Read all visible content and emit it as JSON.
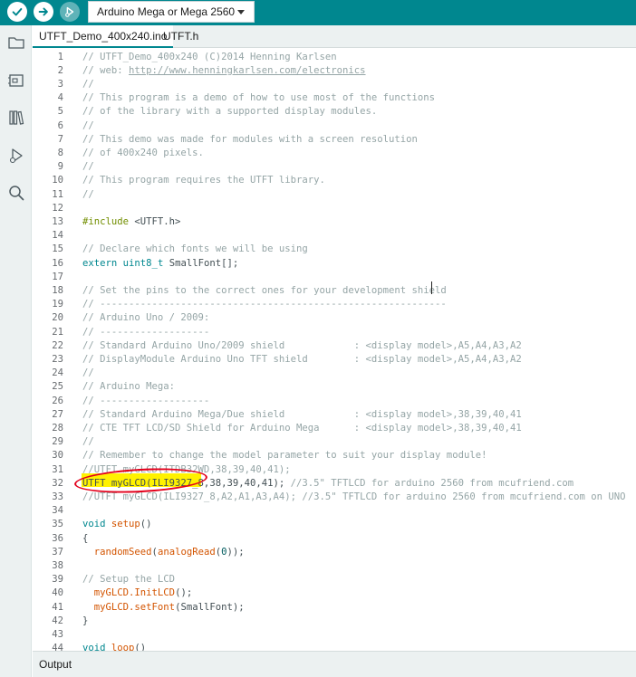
{
  "toolbar": {
    "verify_icon": "check-icon",
    "upload_icon": "arrow-right-icon",
    "debug_icon": "debug-icon",
    "board": "Arduino Mega or Mega 2560"
  },
  "sidebar": {
    "items": [
      {
        "icon": "folder-icon"
      },
      {
        "icon": "board-manager-icon"
      },
      {
        "icon": "library-icon"
      },
      {
        "icon": "debug-icon"
      },
      {
        "icon": "search-icon"
      }
    ]
  },
  "tabs": [
    {
      "label": "UTFT_Demo_400x240.ino",
      "active": true
    },
    {
      "label": "UTFT.h",
      "active": false
    }
  ],
  "code_lines": [
    {
      "n": "1",
      "tokens": [
        {
          "c": "cm",
          "t": "// UTFT_Demo_400x240 (C)2014 Henning Karlsen"
        }
      ]
    },
    {
      "n": "2",
      "tokens": [
        {
          "c": "cm",
          "t": "// web: "
        },
        {
          "c": "cm link",
          "t": "http://www.henningkarlsen.com/electronics"
        }
      ]
    },
    {
      "n": "3",
      "tokens": [
        {
          "c": "cm",
          "t": "//"
        }
      ]
    },
    {
      "n": "4",
      "tokens": [
        {
          "c": "cm",
          "t": "// This program is a demo of how to use most of the functions"
        }
      ]
    },
    {
      "n": "5",
      "tokens": [
        {
          "c": "cm",
          "t": "// of the library with a supported display modules."
        }
      ]
    },
    {
      "n": "6",
      "tokens": [
        {
          "c": "cm",
          "t": "//"
        }
      ]
    },
    {
      "n": "7",
      "tokens": [
        {
          "c": "cm",
          "t": "// This demo was made for modules with a screen resolution"
        }
      ]
    },
    {
      "n": "8",
      "tokens": [
        {
          "c": "cm",
          "t": "// of 400x240 pixels."
        }
      ]
    },
    {
      "n": "9",
      "tokens": [
        {
          "c": "cm",
          "t": "//"
        }
      ]
    },
    {
      "n": "10",
      "tokens": [
        {
          "c": "cm",
          "t": "// This program requires the UTFT library."
        }
      ]
    },
    {
      "n": "11",
      "tokens": [
        {
          "c": "cm",
          "t": "//"
        }
      ]
    },
    {
      "n": "12",
      "tokens": []
    },
    {
      "n": "13",
      "tokens": [
        {
          "c": "pp",
          "t": "#include"
        },
        {
          "c": "tx",
          "t": " <UTFT.h>"
        }
      ]
    },
    {
      "n": "14",
      "tokens": []
    },
    {
      "n": "15",
      "tokens": [
        {
          "c": "cm",
          "t": "// Declare which fonts we will be using"
        }
      ]
    },
    {
      "n": "16",
      "tokens": [
        {
          "c": "kw",
          "t": "extern"
        },
        {
          "c": "tx",
          "t": " "
        },
        {
          "c": "kw",
          "t": "uint8_t"
        },
        {
          "c": "tx",
          "t": " SmallFont[];"
        }
      ]
    },
    {
      "n": "17",
      "tokens": []
    },
    {
      "n": "18",
      "tokens": [
        {
          "c": "cm",
          "t": "// Set the pins to the correct ones for your development shield"
        }
      ]
    },
    {
      "n": "19",
      "tokens": [
        {
          "c": "cm",
          "t": "// ------------------------------------------------------------"
        }
      ]
    },
    {
      "n": "20",
      "tokens": [
        {
          "c": "cm",
          "t": "// Arduino Uno / 2009:"
        }
      ]
    },
    {
      "n": "21",
      "tokens": [
        {
          "c": "cm",
          "t": "// -------------------"
        }
      ]
    },
    {
      "n": "22",
      "tokens": [
        {
          "c": "cm",
          "t": "// Standard Arduino Uno/2009 shield            : <display model>,A5,A4,A3,A2"
        }
      ]
    },
    {
      "n": "23",
      "tokens": [
        {
          "c": "cm",
          "t": "// DisplayModule Arduino Uno TFT shield        : <display model>,A5,A4,A3,A2"
        }
      ]
    },
    {
      "n": "24",
      "tokens": [
        {
          "c": "cm",
          "t": "//"
        }
      ]
    },
    {
      "n": "25",
      "tokens": [
        {
          "c": "cm",
          "t": "// Arduino Mega:"
        }
      ]
    },
    {
      "n": "26",
      "tokens": [
        {
          "c": "cm",
          "t": "// -------------------"
        }
      ]
    },
    {
      "n": "27",
      "tokens": [
        {
          "c": "cm",
          "t": "// Standard Arduino Mega/Due shield            : <display model>,38,39,40,41"
        }
      ]
    },
    {
      "n": "28",
      "tokens": [
        {
          "c": "cm",
          "t": "// CTE TFT LCD/SD Shield for Arduino Mega      : <display model>,38,39,40,41"
        }
      ]
    },
    {
      "n": "29",
      "tokens": [
        {
          "c": "cm",
          "t": "//"
        }
      ]
    },
    {
      "n": "30",
      "tokens": [
        {
          "c": "cm",
          "t": "// Remember to change the model parameter to suit your display module!"
        }
      ]
    },
    {
      "n": "31",
      "tokens": [
        {
          "c": "cm",
          "t": "//UTFT myGLCD(ITDB32WD,38,39,40,41);"
        }
      ]
    },
    {
      "n": "32",
      "tokens": [
        {
          "c": "tx",
          "t": "UTFT myGLCD(ILI9327_8,38,39,40,41); "
        },
        {
          "c": "cm",
          "t": "//3.5\" TFTLCD for arduino 2560 from mcufriend.com"
        }
      ]
    },
    {
      "n": "33",
      "tokens": [
        {
          "c": "cm",
          "t": "//UTFT myGLCD(ILI9327_8,A2,A1,A3,A4); //3.5\" TFTLCD for arduino 2560 from mcufriend.com on UNO"
        }
      ]
    },
    {
      "n": "34",
      "tokens": []
    },
    {
      "n": "35",
      "tokens": [
        {
          "c": "kw",
          "t": "void"
        },
        {
          "c": "tx",
          "t": " "
        },
        {
          "c": "fn",
          "t": "setup"
        },
        {
          "c": "tx",
          "t": "()"
        }
      ]
    },
    {
      "n": "36",
      "tokens": [
        {
          "c": "tx",
          "t": "{"
        }
      ]
    },
    {
      "n": "37",
      "tokens": [
        {
          "c": "tx",
          "t": "  "
        },
        {
          "c": "fn",
          "t": "randomSeed"
        },
        {
          "c": "tx",
          "t": "("
        },
        {
          "c": "fn",
          "t": "analogRead"
        },
        {
          "c": "tx",
          "t": "("
        },
        {
          "c": "num",
          "t": "0"
        },
        {
          "c": "tx",
          "t": "));"
        }
      ]
    },
    {
      "n": "38",
      "tokens": []
    },
    {
      "n": "39",
      "tokens": [
        {
          "c": "cm",
          "t": "// Setup the LCD"
        }
      ]
    },
    {
      "n": "40",
      "tokens": [
        {
          "c": "tx",
          "t": "  "
        },
        {
          "c": "fn",
          "t": "myGLCD.InitLCD"
        },
        {
          "c": "tx",
          "t": "();"
        }
      ]
    },
    {
      "n": "41",
      "tokens": [
        {
          "c": "tx",
          "t": "  "
        },
        {
          "c": "fn",
          "t": "myGLCD.setFont"
        },
        {
          "c": "tx",
          "t": "(SmallFont);"
        }
      ]
    },
    {
      "n": "42",
      "tokens": [
        {
          "c": "tx",
          "t": "}"
        }
      ]
    },
    {
      "n": "43",
      "tokens": []
    },
    {
      "n": "44",
      "tokens": [
        {
          "c": "kw",
          "t": "void"
        },
        {
          "c": "tx",
          "t": " "
        },
        {
          "c": "fn",
          "t": "loop"
        },
        {
          "c": "tx",
          "t": "()"
        }
      ]
    }
  ],
  "output_panel": {
    "label": "Output"
  }
}
